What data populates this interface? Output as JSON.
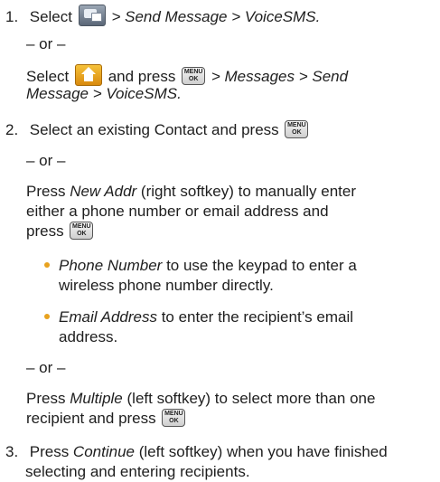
{
  "steps": [
    {
      "number": "1.",
      "lines": [
        {
          "text_a": "Select",
          "text_b": " > Send Message > VoiceSMS."
        },
        {
          "or": "– or –"
        },
        {
          "text_a": "Select",
          "text_b": "and press",
          "text_c": "> Messages > Send"
        },
        {
          "text_a": "Message > VoiceSMS."
        }
      ]
    },
    {
      "number": "2.",
      "text": "Select an existing Contact and press",
      "or1": "– or –",
      "newaddr": {
        "em": "New Addr",
        "rest": " (right softkey) to manually enter",
        "line2": "either a phone number or email address and",
        "line3": "press"
      },
      "bullets": [
        {
          "em": "Phone Number",
          "rest": " to use the keypad to enter a",
          "line2": "wireless phone number directly."
        },
        {
          "em": "Email Address",
          "rest": " to enter the recipient’s email",
          "line2": "address."
        }
      ],
      "or2": "– or –",
      "multiple": {
        "em": "Multiple",
        "rest": " (left softkey) to select more than one",
        "line2": "recipient and press"
      }
    },
    {
      "number": "3.",
      "em": "Continue",
      "rest": " (left softkey) when you have finished",
      "line2": "selecting and entering recipients."
    }
  ],
  "prefix_press": "Press ",
  "key_label_top": "MENU",
  "key_label_bottom": "OK",
  "icons": {
    "message_icon": "messaging-icon",
    "home_icon": "home-icon",
    "key_icon": "menu-ok-key-icon"
  },
  "colors": {
    "bullet": "#e8a21e",
    "text": "#1e1e1e"
  }
}
